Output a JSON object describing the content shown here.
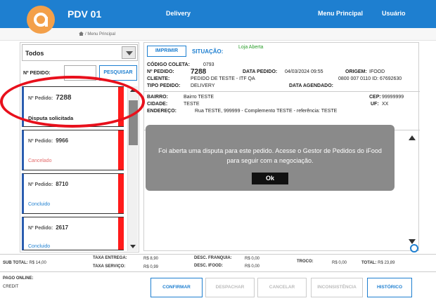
{
  "header": {
    "app_title": "PDV  01",
    "nav": {
      "delivery": "Delivery",
      "menu": "Menu Principal",
      "user": "Usuário"
    },
    "breadcrumb": "/ Menu Principal"
  },
  "filter": {
    "selected": "Todos",
    "pedido_label": "Nº PEDIDO:",
    "search_button": "PESQUISAR"
  },
  "orders": [
    {
      "label": "Nº Pedido:",
      "number": "7288",
      "status": "Disputa solicitada",
      "status_color": "#222222"
    },
    {
      "label": "Nº Pedido:",
      "number": "9966",
      "status": "Cancelado",
      "status_color": "#e36a6a"
    },
    {
      "label": "Nº Pedido:",
      "number": "8710",
      "status": "Concluido",
      "status_color": "#1e7fd0"
    },
    {
      "label": "Nº Pedido:",
      "number": "2617",
      "status": "Concluido",
      "status_color": "#1e7fd0"
    }
  ],
  "detail": {
    "print_button": "IMPRIMIR",
    "situacao_label": "SITUAÇÃO:",
    "situacao_value": "Loja Aberta",
    "codigo_coleta_label": "CÓDIGO COLETA:",
    "codigo_coleta_value": "0793",
    "pedido_label": "Nº PEDIDO:",
    "pedido_value": "7288",
    "data_pedido_label": "DATA PEDIDO:",
    "data_pedido_value": "04/03/2024 09:55",
    "origem_label": "ORIGEM:",
    "origem_value": "IFOOD",
    "cliente_label": "CLIENTE:",
    "cliente_value": "PEDIDO DE TESTE - ITF QA",
    "telefone_value": "0800 007 0110 ID: 67692630",
    "tipo_label": "TIPO PEDIDO:",
    "tipo_value": "DELIVERY",
    "data_agendado_label": "DATA AGENDADO:",
    "bairro_label": "BAIRRO:",
    "bairro_value": "Bairro TESTE",
    "cep_label": "CEP:",
    "cep_value": "99999999",
    "cidade_label": "CIDADE:",
    "cidade_value": "TESTE",
    "uf_label": "UF:",
    "uf_value": "XX",
    "endereco_label": "ENDEREÇO:",
    "endereco_value": "Rua TESTE, 999999 - Complemento TESTE - referência: TESTE"
  },
  "modal": {
    "message": "Foi aberta uma disputa para este pedido. Acesse o Gestor de Pedidos do iFood para seguir com a negociação.",
    "ok": "Ok"
  },
  "totals": {
    "subtotal_label": "SUB TOTAL:",
    "subtotal_value": "R$ 14,00",
    "taxa_entrega_label": "TAXA ENTREGA:",
    "taxa_entrega_value": "R$ 8,90",
    "taxa_servico_label": "TAXA SERVIÇO:",
    "taxa_servico_value": "R$ 0,99",
    "desc_franquia_label": "DESC. FRANQUIA:",
    "desc_franquia_value": "R$ 0,00",
    "desc_ifood_label": "DESC. IFOOD:",
    "desc_ifood_value": "R$ 0,00",
    "troco_label": "TROCO:",
    "troco_value": "R$ 0,00",
    "total_label": "TOTAL:",
    "total_value": "R$ 23,89"
  },
  "footer": {
    "pago_label": "PAGO ONLINE:",
    "pago_value": "CREDIT",
    "buttons": [
      "CONFIRMAR",
      "DESPACHAR",
      "CANCELAR",
      "INCONSISTÊNCIA",
      "HISTÓRICO"
    ]
  },
  "colors": {
    "accent": "#1e7fd0",
    "logo": "#f3a04a",
    "alert": "#e8101c"
  }
}
